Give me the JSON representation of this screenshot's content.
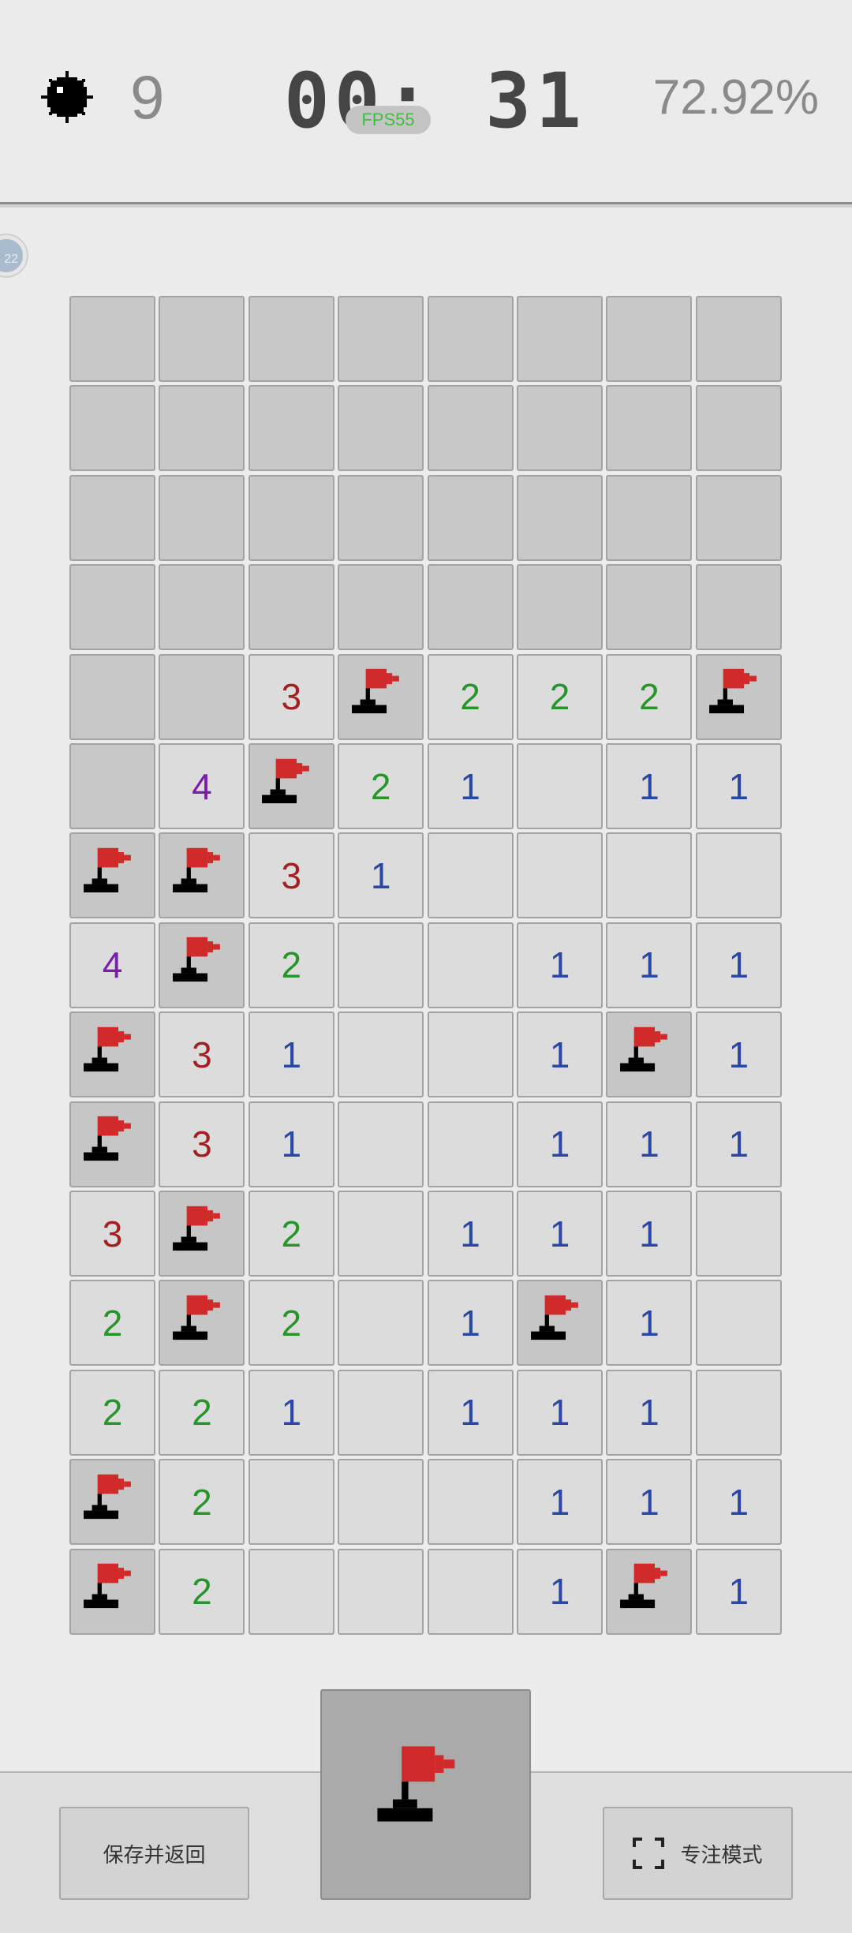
{
  "header": {
    "mine_icon": "mine-icon",
    "mines_remaining": "9",
    "timer": "00: 31",
    "fps_label": "FPS55",
    "progress": "72.92%"
  },
  "side_avatar_text": "22",
  "board": {
    "columns": 8,
    "rows": [
      [
        "H",
        "H",
        "H",
        "H",
        "H",
        "H",
        "H",
        "H"
      ],
      [
        "H",
        "H",
        "H",
        "H",
        "H",
        "H",
        "H",
        "H"
      ],
      [
        "H",
        "H",
        "H",
        "H",
        "H",
        "H",
        "H",
        "H"
      ],
      [
        "H",
        "H",
        "H",
        "H",
        "H",
        "H",
        "H",
        "H"
      ],
      [
        "H",
        "H",
        "3",
        "F",
        "2",
        "2",
        "2",
        "F"
      ],
      [
        "H",
        "4",
        "F",
        "2",
        "1",
        "0",
        "1",
        "1"
      ],
      [
        "F",
        "F",
        "3",
        "1",
        "0",
        "0",
        "0",
        "0"
      ],
      [
        "4",
        "F",
        "2",
        "0",
        "0",
        "1",
        "1",
        "1"
      ],
      [
        "F",
        "3",
        "1",
        "0",
        "0",
        "1",
        "F",
        "1"
      ],
      [
        "F",
        "3",
        "1",
        "0",
        "0",
        "1",
        "1",
        "1"
      ],
      [
        "3",
        "F",
        "2",
        "0",
        "1",
        "1",
        "1",
        "0"
      ],
      [
        "2",
        "F",
        "2",
        "0",
        "1",
        "F",
        "1",
        "0"
      ],
      [
        "2",
        "2",
        "1",
        "0",
        "1",
        "1",
        "1",
        "0"
      ],
      [
        "F",
        "2",
        "0",
        "0",
        "0",
        "1",
        "1",
        "1"
      ],
      [
        "F",
        "2",
        "0",
        "0",
        "0",
        "1",
        "F",
        "1"
      ]
    ],
    "legend": {
      "H": "hidden",
      "F": "flag",
      "0": "empty"
    }
  },
  "controls": {
    "save_label": "保存并返回",
    "focus_label": "专注模式",
    "focus_icon": "fullscreen-icon",
    "mode_icon": "flag-icon"
  },
  "colors": {
    "n1": "#2a47a6",
    "n2": "#27952a",
    "n3": "#a32020",
    "n4": "#7a1ea8",
    "flag": "#d12a2a"
  }
}
